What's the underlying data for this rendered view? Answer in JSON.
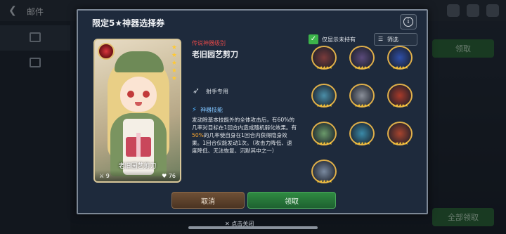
{
  "screen": {
    "title": "邮件"
  },
  "dialog": {
    "title": "限定5★神器选择券",
    "info_label": "i",
    "artifact": {
      "rank": "传说神器级别",
      "name": "老旧园艺剪刀",
      "role": "射手专用",
      "skill_title": "神器技能",
      "skill_desc_part1": "发动除基本技能外的全体攻击后，有60%的几率对目标在1回合内造成随机弱化效果。有",
      "skill_desc_highlight": "50%",
      "skill_desc_part2": "的几率使自身在1回合内获得隐身效果。1回合仅能发动1次。（攻击力降低、速度降低、无法恢复、沉默其中之一）",
      "card_name": "老旧园艺剪刀",
      "card_left_value": "9",
      "card_right_value": "76"
    },
    "filter": {
      "show_unowned_label": "仅显示未持有",
      "show_unowned_checked": true,
      "sort_label": "筛选"
    },
    "grid": [
      {
        "name": "artifact-1",
        "color": "#7a3b3b",
        "stars": "★★★★★"
      },
      {
        "name": "artifact-2",
        "color": "#5a4a7a",
        "stars": "★★★★★"
      },
      {
        "name": "artifact-3",
        "color": "#2f4fa8",
        "stars": "★★★★★"
      },
      {
        "name": "artifact-4",
        "color": "#4a8ea8",
        "stars": "★★★★★"
      },
      {
        "name": "artifact-5",
        "color": "#8a8f99",
        "stars": "★★★★★"
      },
      {
        "name": "artifact-6",
        "color": "#a83a2a",
        "stars": "★★★★★"
      },
      {
        "name": "artifact-7",
        "color": "#6a9a6a",
        "stars": "★★★★★"
      },
      {
        "name": "artifact-8",
        "color": "#3a8aa8",
        "stars": "★★★★★"
      },
      {
        "name": "artifact-9",
        "color": "#a8442e",
        "stars": "★★★★★"
      },
      {
        "name": "artifact-10",
        "color": "#7a8aa0",
        "stars": "★★★★★"
      }
    ],
    "buttons": {
      "cancel": "取消",
      "confirm": "领取"
    }
  },
  "background": {
    "right_button": "领取",
    "bottom_button": "全部领取"
  },
  "footer": {
    "close_hint": "✕ 点击关闭"
  }
}
